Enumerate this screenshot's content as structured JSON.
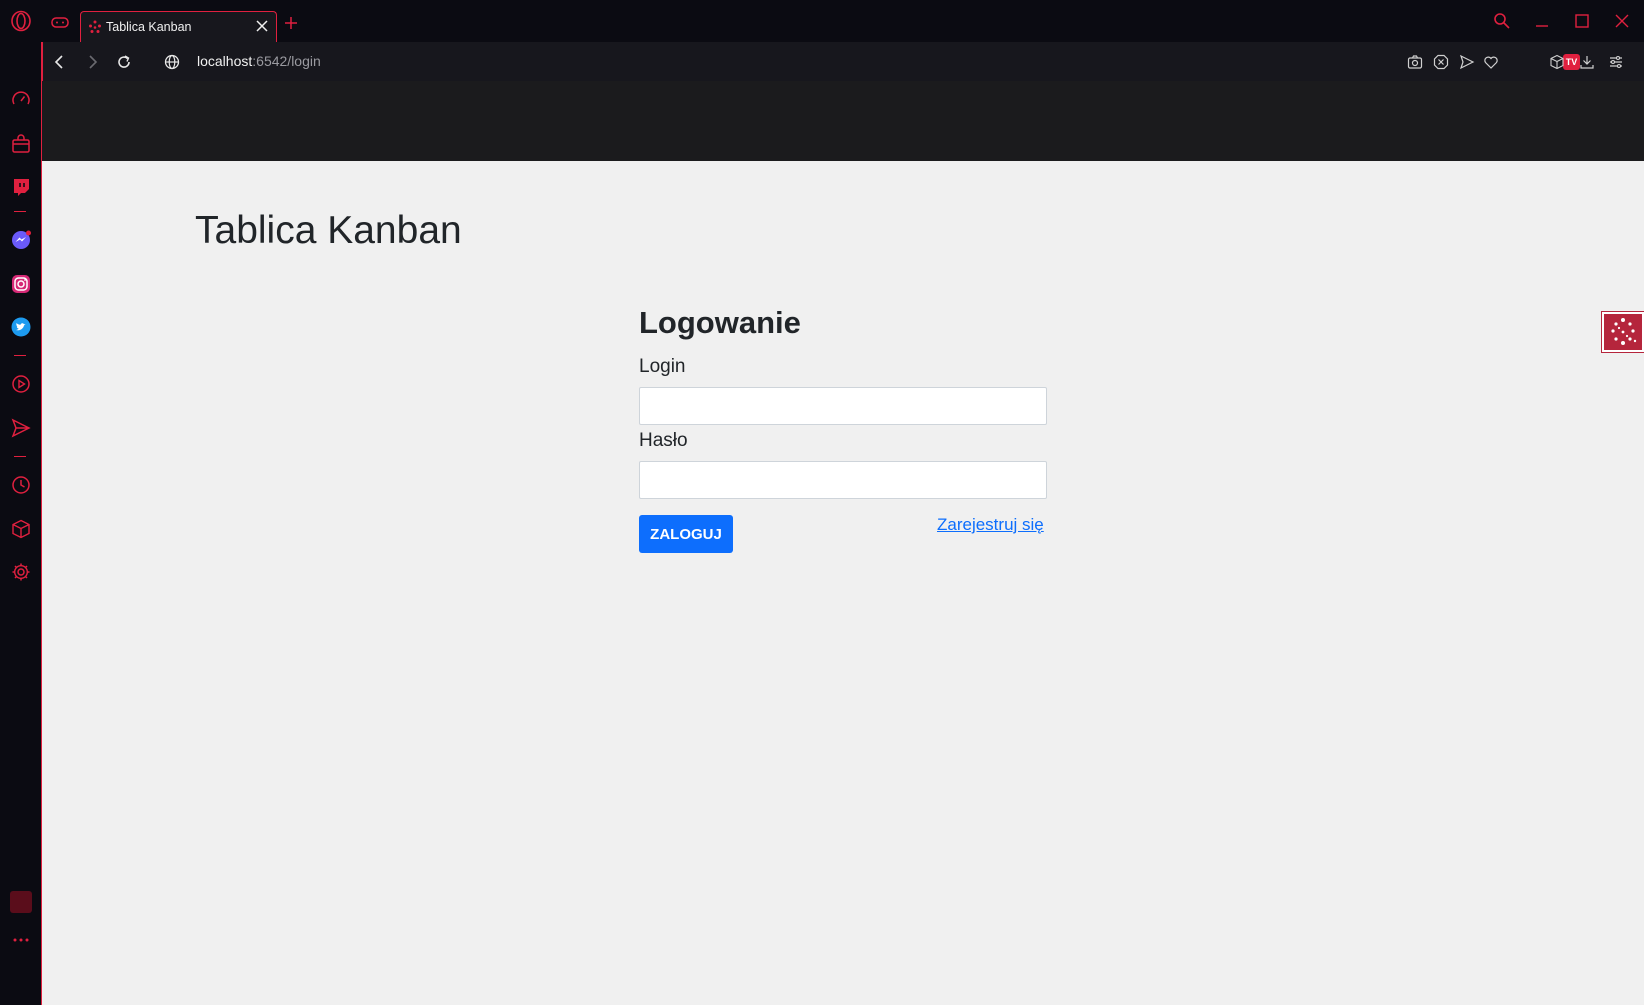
{
  "browser": {
    "tab": {
      "title": "Tablica Kanban"
    },
    "address": {
      "host": "localhost",
      "path": ":6542/login"
    },
    "tv_badge": "TV",
    "accent_color": "#e0203f"
  },
  "sidebar": {
    "icons": [
      "speed-dial-icon",
      "shopping-bag-icon",
      "twitch-icon",
      "messenger-icon",
      "instagram-icon",
      "twitter-icon",
      "player-icon",
      "send-icon",
      "history-icon",
      "extensions-icon",
      "settings-icon",
      "profile-icon",
      "more-icon"
    ]
  },
  "page": {
    "app_title": "Tablica Kanban",
    "login_heading": "Logowanie",
    "login_label": "Login",
    "login_value": "",
    "password_label": "Hasło",
    "password_value": "",
    "submit_label": "ZALOGUJ",
    "register_link": "Zarejestruj się",
    "button_color": "#0d6efd"
  }
}
